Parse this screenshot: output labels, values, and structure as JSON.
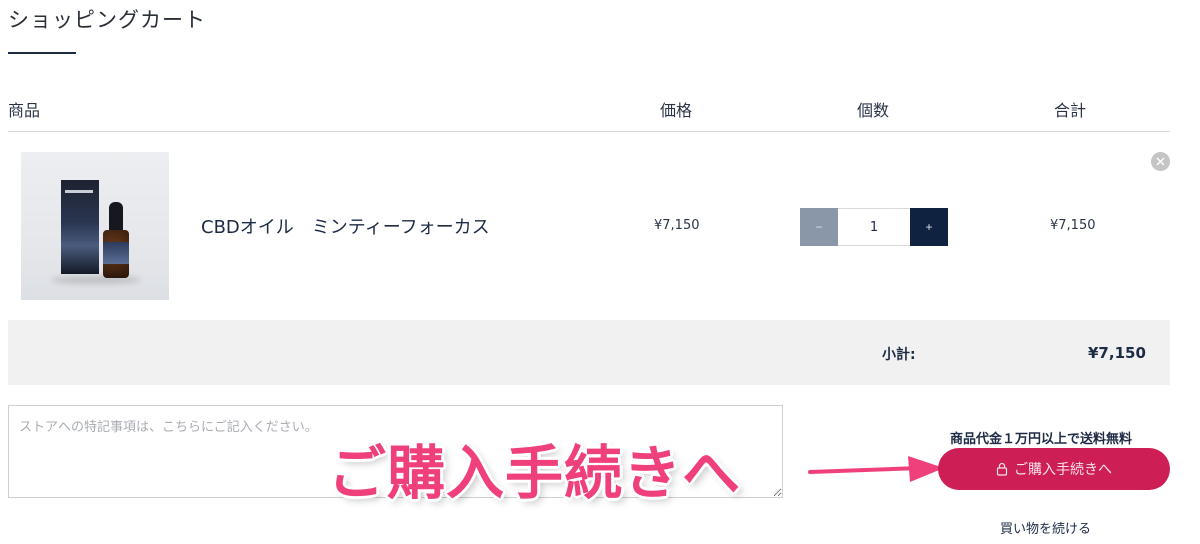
{
  "page": {
    "title": "ショッピングカート"
  },
  "table": {
    "headers": {
      "product": "商品",
      "price": "価格",
      "quantity": "個数",
      "total": "合計"
    }
  },
  "items": [
    {
      "name": "CBDオイル　ミンティーフォーカス",
      "price": "¥7,150",
      "quantity": "1",
      "total": "¥7,150",
      "image_icon": "cbd-oil-bottle-product-photo"
    }
  ],
  "stepper": {
    "minus": "−",
    "plus": "+"
  },
  "subtotal": {
    "label": "小計:",
    "value": "¥7,150"
  },
  "note": {
    "placeholder": "ストアへの特記事項は、こちらにご記入ください。"
  },
  "overlay": {
    "text": "ご購入手続きへ",
    "color": "#f0407b"
  },
  "checkout": {
    "free_shipping": "商品代金１万円以上で送料無料",
    "button_label": "ご購入手続きへ",
    "button_icon": "lock-icon",
    "button_color": "#cd1f55"
  },
  "continue_shopping": "買い物を続ける",
  "colors": {
    "navy": "#1d2b45",
    "stepper_minus": "#8a97a8",
    "stepper_plus": "#0f2240"
  }
}
